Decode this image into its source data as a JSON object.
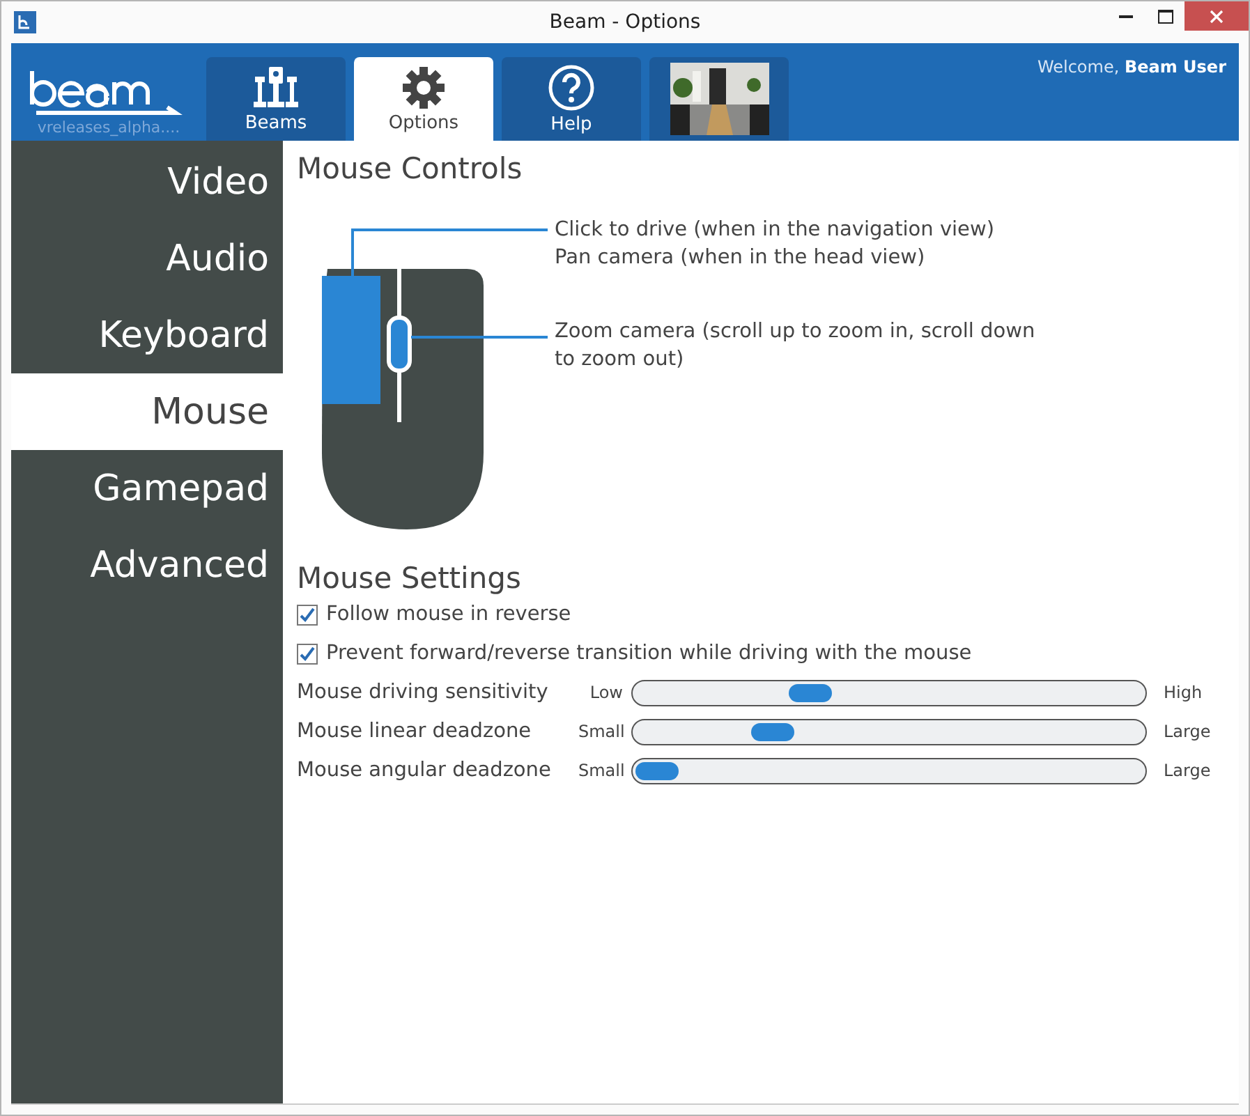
{
  "window": {
    "title": "Beam - Options"
  },
  "header": {
    "server": "vreleases_alpha....",
    "welcome": "Welcome, ",
    "user": "Beam User"
  },
  "tabs": [
    {
      "kind": "beams",
      "label": "Beams",
      "selected": false
    },
    {
      "kind": "options",
      "label": "Options",
      "selected": true
    },
    {
      "kind": "help",
      "label": "Help",
      "selected": false
    },
    {
      "kind": "picture",
      "selected": false
    }
  ],
  "sidebar": {
    "items": [
      {
        "label": "Video",
        "selected": false
      },
      {
        "label": "Audio",
        "selected": false
      },
      {
        "label": "Keyboard",
        "selected": false
      },
      {
        "label": "Mouse",
        "selected": true
      },
      {
        "label": "Gamepad",
        "selected": false
      },
      {
        "label": "Advanced",
        "selected": false
      }
    ]
  },
  "controls": {
    "title": "Mouse Controls",
    "left_button": [
      "Click to drive (when in the navigation view)",
      "Pan camera (when in the head view)"
    ],
    "wheel": "Zoom camera (scroll up to zoom in, scroll down to zoom out)"
  },
  "settings": {
    "title": "Mouse Settings",
    "checkboxes": [
      {
        "label": "Follow mouse in reverse",
        "checked": true
      },
      {
        "label": "Prevent forward/reverse transition while driving with the mouse",
        "checked": true
      }
    ],
    "sliders": [
      {
        "label": "Mouse driving sensitivity",
        "min": "Low",
        "max": "High",
        "level": 0.33
      },
      {
        "label": "Mouse linear deadzone",
        "min": "Small",
        "max": "Large",
        "level": 0.25
      },
      {
        "label": "Mouse angular deadzone",
        "min": "Small",
        "max": "Large",
        "level": 0
      }
    ]
  }
}
